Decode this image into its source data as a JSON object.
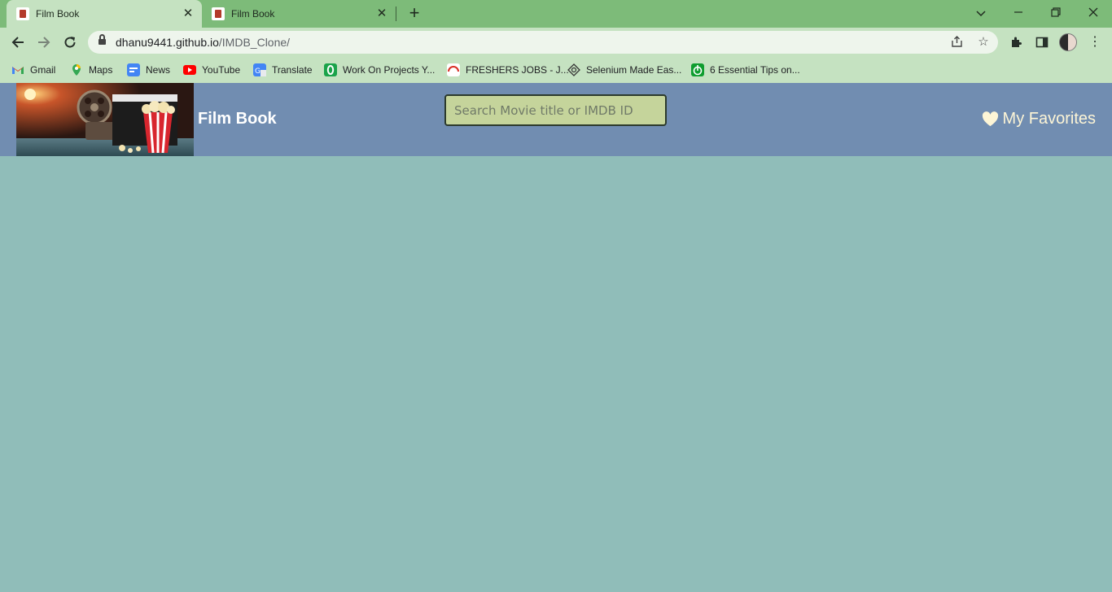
{
  "browser": {
    "tabs": [
      {
        "title": "Film Book",
        "active": true
      },
      {
        "title": "Film Book",
        "active": false
      }
    ],
    "url_host": "dhanu9441.github.io",
    "url_path": "/IMDB_Clone/",
    "bookmarks": [
      {
        "label": "Gmail",
        "icon": "gmail-icon"
      },
      {
        "label": "Maps",
        "icon": "maps-icon"
      },
      {
        "label": "News",
        "icon": "news-icon"
      },
      {
        "label": "YouTube",
        "icon": "youtube-icon"
      },
      {
        "label": "Translate",
        "icon": "translate-icon"
      },
      {
        "label": "Work On Projects Y...",
        "icon": "projects-icon"
      },
      {
        "label": "FRESHERS JOBS - J...",
        "icon": "jobs-icon"
      },
      {
        "label": "Selenium Made Eas...",
        "icon": "selenium-icon"
      },
      {
        "label": "6 Essential Tips on...",
        "icon": "tips-icon"
      }
    ]
  },
  "site": {
    "brand": "Film Book",
    "search_placeholder": "Search Movie title or IMDB ID",
    "favorites_label": "My Favorites"
  },
  "colors": {
    "tabstrip": "#7dbb79",
    "toolbar": "#c5e2c1",
    "header": "#718db1",
    "page_bg": "#90bdb9",
    "search_bg": "#c5d49b",
    "favorites": "#fdf5d6"
  }
}
